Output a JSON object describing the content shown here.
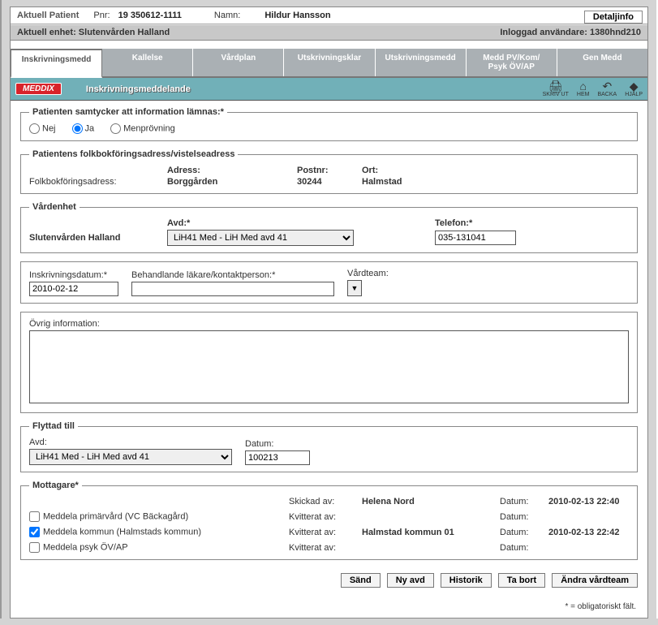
{
  "header": {
    "aktuell_patient_lbl": "Aktuell Patient",
    "pnr_lbl": "Pnr:",
    "pnr_val": "19 350612-1111",
    "namn_lbl": "Namn:",
    "namn_val": "Hildur Hansson",
    "detail_btn": "Detaljinfo",
    "aktuell_enhet_lbl": "Aktuell enhet:",
    "aktuell_enhet_val": "Slutenvården Halland",
    "loggin_lbl": "Inloggad användare:",
    "loggin_val": "1380hnd210"
  },
  "tabs": {
    "t0": "Inskrivningsmedd",
    "t1": "Kallelse",
    "t2": "Vårdplan",
    "t3": "Utskrivningsklar",
    "t4": "Utskrivningsmedd",
    "t5": "Medd PV/Kom/\nPsyk ÖV/AP",
    "t6": "Gen Medd"
  },
  "titlebar": {
    "logo": "MEDDIX",
    "title": "Inskrivningsmeddelande",
    "icons": {
      "print": "SKRIV UT",
      "home": "HEM",
      "back": "BACKA",
      "help": "HJÄLP"
    }
  },
  "consent": {
    "legend": "Patienten samtycker att information lämnas:*",
    "nej": "Nej",
    "ja": "Ja",
    "men": "Menprövning"
  },
  "address": {
    "legend": "Patientens folkbokföringsadress/vistelseadress",
    "adress_lbl": "Adress:",
    "postnr_lbl": "Postnr:",
    "ort_lbl": "Ort:",
    "folklbl": "Folkbokföringsadress:",
    "adress_val": "Borggården",
    "postnr_val": "30244",
    "ort_val": "Halmstad"
  },
  "vard": {
    "legend": "Vårdenhet",
    "avd_lbl": "Avd:*",
    "tel_lbl": "Telefon:*",
    "enhet": "Slutenvården Halland",
    "avd_sel": "LiH41 Med - LiH Med avd 41",
    "tel_val": "035-131041"
  },
  "care": {
    "ins_lbl": "Inskrivningsdatum:*",
    "ins_val": "2010-02-12",
    "beh_lbl": "Behandlande läkare/kontaktperson:*",
    "beh_val": "",
    "team_lbl": "Vårdteam:"
  },
  "ovrig": {
    "lbl": "Övrig information:",
    "val": ""
  },
  "flyt": {
    "legend": "Flyttad till",
    "avd_lbl": "Avd:",
    "avd_sel": "LiH41 Med - LiH Med avd 41",
    "datum_lbl": "Datum:",
    "datum_val": "100213"
  },
  "mot": {
    "legend": "Mottagare*",
    "c1": "Meddela primärvård  (VC Bäckagård)",
    "c2": "Meddela kommun  (Halmstads kommun)",
    "c3": "Meddela psyk ÖV/AP",
    "skickad_lbl": "Skickad av:",
    "skickad_val": "Helena Nord",
    "kvit_lbl": "Kvitterat av:",
    "kvit_val1": "",
    "kvit_val2": "Halmstad kommun 01",
    "datum_lbl": "Datum:",
    "d1": "2010-02-13 22:40",
    "d2": "",
    "d3": "2010-02-13 22:42",
    "d4": ""
  },
  "footer": {
    "sand": "Sänd",
    "nyavd": "Ny avd",
    "hist": "Historik",
    "tabort": "Ta bort",
    "andra": "Ändra vårdteam",
    "note": "* = obligatoriskt fält."
  }
}
